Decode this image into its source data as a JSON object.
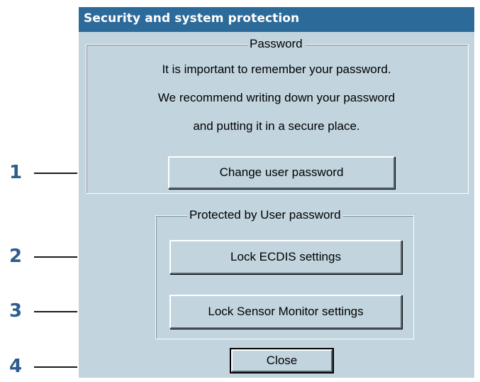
{
  "dialog": {
    "title": "Security and system protection",
    "password_group": {
      "legend": "Password",
      "lines": [
        "It is important to remember your password.",
        "We recommend writing down your password",
        "and putting it in a secure place."
      ],
      "change_password_label": "Change user password"
    },
    "protected_group": {
      "legend": "Protected by User password",
      "lock_ecdis_label": "Lock ECDIS settings",
      "lock_sensor_label": "Lock Sensor Monitor settings"
    },
    "close_label": "Close"
  },
  "callouts": [
    "1",
    "2",
    "3",
    "4"
  ],
  "colors": {
    "title_bar": "#2c6a9a",
    "dialog_background": "#c2d5df",
    "callout_number": "#2c5d8e"
  }
}
